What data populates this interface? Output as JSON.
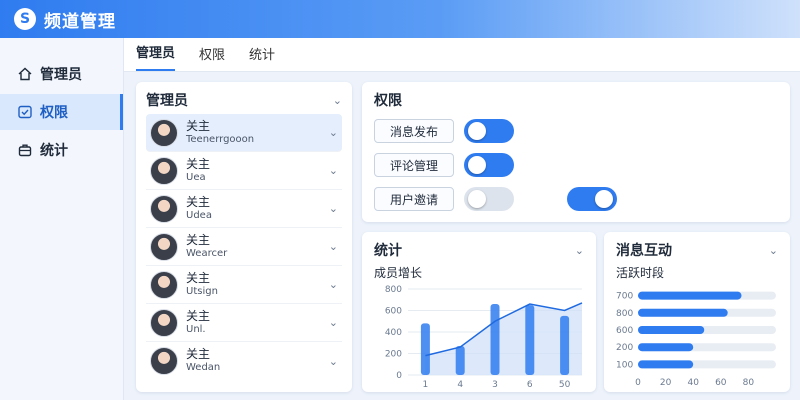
{
  "app": {
    "title": "频道管理",
    "logo_icon": "swirl-logo-icon"
  },
  "sidebar": {
    "items": [
      {
        "label": "管理员",
        "icon": "home-icon",
        "active": false
      },
      {
        "label": "权限",
        "icon": "check-box-icon",
        "active": true
      },
      {
        "label": "统计",
        "icon": "briefcase-icon",
        "active": false
      }
    ]
  },
  "tabs": [
    {
      "label": "管理员",
      "active": true
    },
    {
      "label": "权限",
      "active": false
    },
    {
      "label": "统计",
      "active": false
    }
  ],
  "admins": {
    "title": "管理员",
    "members": [
      {
        "role": "关主",
        "name": "Teenerrgooon",
        "selected": true
      },
      {
        "role": "关主",
        "name": "Uea",
        "selected": false
      },
      {
        "role": "关主",
        "name": "Udea",
        "selected": false
      },
      {
        "role": "关主",
        "name": "Wearcer",
        "selected": false
      },
      {
        "role": "关主",
        "name": "Utsign",
        "selected": false
      },
      {
        "role": "关主",
        "name": "Unl.",
        "selected": false
      },
      {
        "role": "关主",
        "name": "Wedan",
        "selected": false
      }
    ]
  },
  "permissions": {
    "title": "权限",
    "rows": [
      {
        "label": "消息发布",
        "enabled": true
      },
      {
        "label": "评论管理",
        "enabled": true
      },
      {
        "label": "用户邀请",
        "enabled": false
      }
    ],
    "extra_toggle_enabled": true
  },
  "stats": {
    "title": "统计",
    "subtitle": "成员增长"
  },
  "interaction": {
    "title": "消息互动",
    "subtitle": "活跃时段"
  },
  "colors": {
    "accent": "#2f7cf0",
    "toggle_off": "#dde3ec",
    "area_fill": "#cfe0fa"
  },
  "chart_data": [
    {
      "type": "bar",
      "title": "成员增长",
      "categories": [
        "1",
        "4",
        "3",
        "6",
        "50"
      ],
      "yticks": [
        "800",
        "600",
        "400",
        "200",
        "0"
      ],
      "ylim": [
        0,
        800
      ],
      "series": [
        {
          "type": "bar",
          "values": [
            480,
            270,
            660,
            650,
            550
          ]
        },
        {
          "type": "area",
          "x": [
            0,
            1,
            2,
            3,
            4,
            4.5
          ],
          "values": [
            180,
            260,
            500,
            660,
            600,
            670
          ]
        }
      ],
      "grid": true
    },
    {
      "type": "bar",
      "orientation": "horizontal",
      "title": "活跃时段",
      "categories": [
        "700",
        "800",
        "600",
        "200",
        "100"
      ],
      "values": [
        75,
        65,
        48,
        40,
        40
      ],
      "xticks": [
        "0",
        "20",
        "40",
        "60",
        "80"
      ],
      "xlim": [
        0,
        100
      ],
      "grid": true
    }
  ]
}
